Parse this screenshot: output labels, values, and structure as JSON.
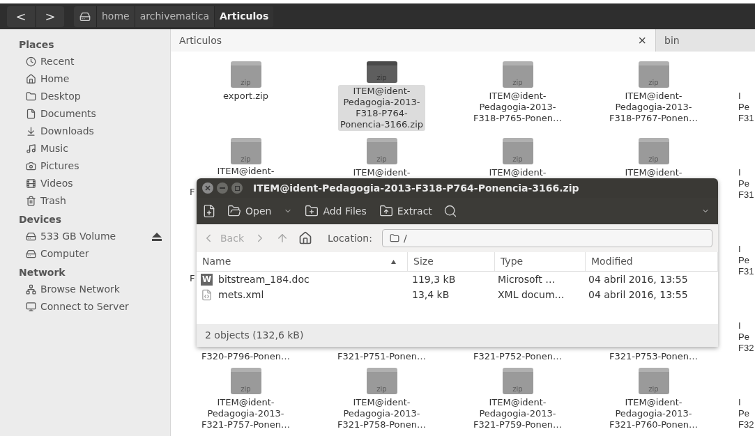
{
  "toolbar": {
    "back": "<",
    "forward": ">",
    "path": [
      {
        "label": "home",
        "selected": false
      },
      {
        "label": "archivematica",
        "selected": false
      },
      {
        "label": "Articulos",
        "selected": true
      }
    ]
  },
  "sidebar": [
    {
      "title": "Places",
      "items": [
        {
          "label": "Recent",
          "ejectable": false
        },
        {
          "label": "Home",
          "ejectable": false
        },
        {
          "label": "Desktop",
          "ejectable": false
        },
        {
          "label": "Documents",
          "ejectable": false
        },
        {
          "label": "Downloads",
          "ejectable": false
        },
        {
          "label": "Music",
          "ejectable": false
        },
        {
          "label": "Pictures",
          "ejectable": false
        },
        {
          "label": "Videos",
          "ejectable": false
        },
        {
          "label": "Trash",
          "ejectable": false
        }
      ]
    },
    {
      "title": "Devices",
      "items": [
        {
          "label": "533 GB Volume",
          "ejectable": true
        },
        {
          "label": "Computer",
          "ejectable": false
        }
      ]
    },
    {
      "title": "Network",
      "items": [
        {
          "label": "Browse Network",
          "ejectable": false
        },
        {
          "label": "Connect to Server",
          "ejectable": false
        }
      ]
    }
  ],
  "tabs": [
    {
      "label": "Articulos",
      "selected": true,
      "close": "×"
    },
    {
      "label": "bin",
      "selected": false
    }
  ],
  "grid": [
    [
      {
        "kind": "icon",
        "icon_label": "zip",
        "selected": false,
        "lines": [
          "export.zip"
        ]
      },
      {
        "kind": "icon",
        "icon_label": "zip",
        "selected": true,
        "lines": [
          "ITEM@ident-",
          "Pedagogia-2013-",
          "F318-P764-",
          "Ponencia-3166.zip"
        ]
      },
      {
        "kind": "icon",
        "icon_label": "zip",
        "selected": false,
        "lines": [
          "ITEM@ident-",
          "Pedagogia-2013-",
          "F318-P765-Ponen…"
        ]
      },
      {
        "kind": "icon",
        "icon_label": "zip",
        "selected": false,
        "lines": [
          "ITEM@ident-",
          "Pedagogia-2013-",
          "F318-P767-Ponen…"
        ]
      },
      {
        "kind": "edge",
        "selected": false,
        "lines": [
          "I",
          "Pe",
          "F31"
        ]
      }
    ],
    [
      {
        "kind": "icon_split",
        "icon_label": "zip",
        "selected": false,
        "lines": [
          "ITEM@ident-",
          "F"
        ]
      },
      {
        "kind": "icon",
        "icon_label": "zip",
        "selected": false,
        "lines": [
          "ITEM@ident-"
        ]
      },
      {
        "kind": "icon",
        "icon_label": "zip",
        "selected": false,
        "lines": [
          "ITEM@ident-"
        ]
      },
      {
        "kind": "icon",
        "icon_label": "zip",
        "selected": false,
        "lines": [
          "ITEM@ident-"
        ]
      },
      {
        "kind": "edge",
        "selected": false,
        "lines": [
          "I",
          "Pe",
          "F31"
        ]
      }
    ],
    [
      {
        "kind": "tail_left",
        "selected": false,
        "lines": [
          "F"
        ]
      },
      {
        "kind": "empty"
      },
      {
        "kind": "empty"
      },
      {
        "kind": "empty"
      },
      {
        "kind": "edge",
        "selected": false,
        "lines": [
          "I",
          "Pe",
          "F31"
        ]
      }
    ],
    [
      {
        "kind": "tail",
        "selected": false,
        "lines": [
          "F320-P796-Ponen…"
        ]
      },
      {
        "kind": "tail",
        "selected": false,
        "lines": [
          "F321-P751-Ponen…"
        ]
      },
      {
        "kind": "tail",
        "selected": false,
        "lines": [
          "F321-P752-Ponen…"
        ]
      },
      {
        "kind": "tail",
        "selected": false,
        "lines": [
          "F321-P753-Ponen…"
        ]
      },
      {
        "kind": "edge",
        "selected": false,
        "lines": [
          "I",
          "Pe",
          "F32"
        ]
      }
    ],
    [
      {
        "kind": "icon",
        "icon_label": "zip",
        "selected": false,
        "lines": [
          "ITEM@ident-",
          "Pedagogia-2013-",
          "F321-P757-Ponen…"
        ]
      },
      {
        "kind": "icon",
        "icon_label": "zip",
        "selected": false,
        "lines": [
          "ITEM@ident-",
          "Pedagogia-2013-",
          "F321-P758-Ponen…"
        ]
      },
      {
        "kind": "icon",
        "icon_label": "zip",
        "selected": false,
        "lines": [
          "ITEM@ident-",
          "Pedagogia-2013-",
          "F321-P759-Ponen…"
        ]
      },
      {
        "kind": "icon",
        "icon_label": "zip",
        "selected": false,
        "lines": [
          "ITEM@ident-",
          "Pedagogia-2013-",
          "F321-P760-Ponen…"
        ]
      },
      {
        "kind": "edge",
        "selected": false,
        "lines": [
          "I",
          "Pe",
          "F32"
        ]
      }
    ]
  ],
  "archive_window": {
    "title": "ITEM@ident-Pedagogia-2013-F318-P764-Ponencia-3166.zip",
    "toolbar": [
      {
        "kind": "new"
      },
      {
        "kind": "open",
        "label": "Open",
        "menu": true
      },
      {
        "kind": "add",
        "label": "Add Files",
        "menu": false
      },
      {
        "kind": "extract",
        "label": "Extract",
        "menu": false
      },
      {
        "kind": "search"
      }
    ],
    "nav": {
      "back": {
        "label": "Back",
        "disabled": true
      },
      "forward_disabled": true,
      "up_disabled": true
    },
    "location": {
      "label": "Location:",
      "value": "/"
    },
    "columns": [
      {
        "label": "Name",
        "sorted": true
      },
      {
        "label": "Size",
        "sorted": false
      },
      {
        "label": "Type",
        "sorted": false
      },
      {
        "label": "Modified",
        "sorted": false
      }
    ],
    "files": [
      {
        "kind": "word",
        "icon_text": "W",
        "name": "bitstream_184.doc",
        "size": "119,3 kB",
        "type": "Microsoft …",
        "modified": "04 abril 2016, 13:55"
      },
      {
        "kind": "xml",
        "name": "mets.xml",
        "size": "13,4 kB",
        "type": "XML docum…",
        "modified": "04 abril 2016, 13:55"
      }
    ],
    "status": "2 objects (132,6 kB)"
  }
}
